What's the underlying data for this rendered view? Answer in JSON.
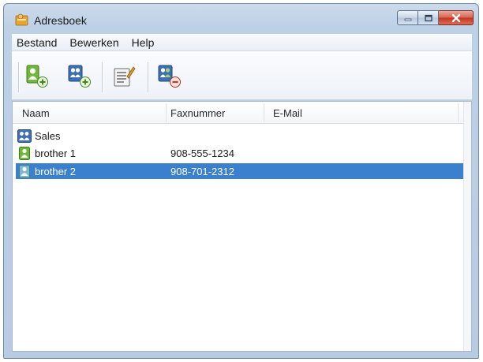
{
  "window": {
    "title": "Adresboek",
    "icon": "address-book-icon",
    "controls": [
      "minimize-icon",
      "maximize-icon",
      "close-icon"
    ],
    "close_color": "#c5331d"
  },
  "menu": {
    "items": [
      {
        "label": "Bestand"
      },
      {
        "label": "Bewerken"
      },
      {
        "label": "Help"
      }
    ]
  },
  "toolbar": {
    "buttons": [
      {
        "icon": "add-contact-icon"
      },
      {
        "icon": "add-group-icon"
      },
      {
        "icon": "edit-icon"
      },
      {
        "icon": "delete-icon"
      }
    ]
  },
  "list": {
    "columns": [
      "Naam",
      "Faxnummer",
      "E-Mail"
    ],
    "rows": [
      {
        "name": "Sales",
        "fax": "",
        "email": "",
        "icon": "group-icon",
        "selected": false
      },
      {
        "name": "brother 1",
        "fax": "908-555-1234",
        "email": "",
        "icon": "contact-icon",
        "selected": false
      },
      {
        "name": "brother 2",
        "fax": "908-701-2312",
        "email": "",
        "icon": "contact-icon",
        "selected": true
      }
    ],
    "selection_color": "#3a80cf"
  }
}
